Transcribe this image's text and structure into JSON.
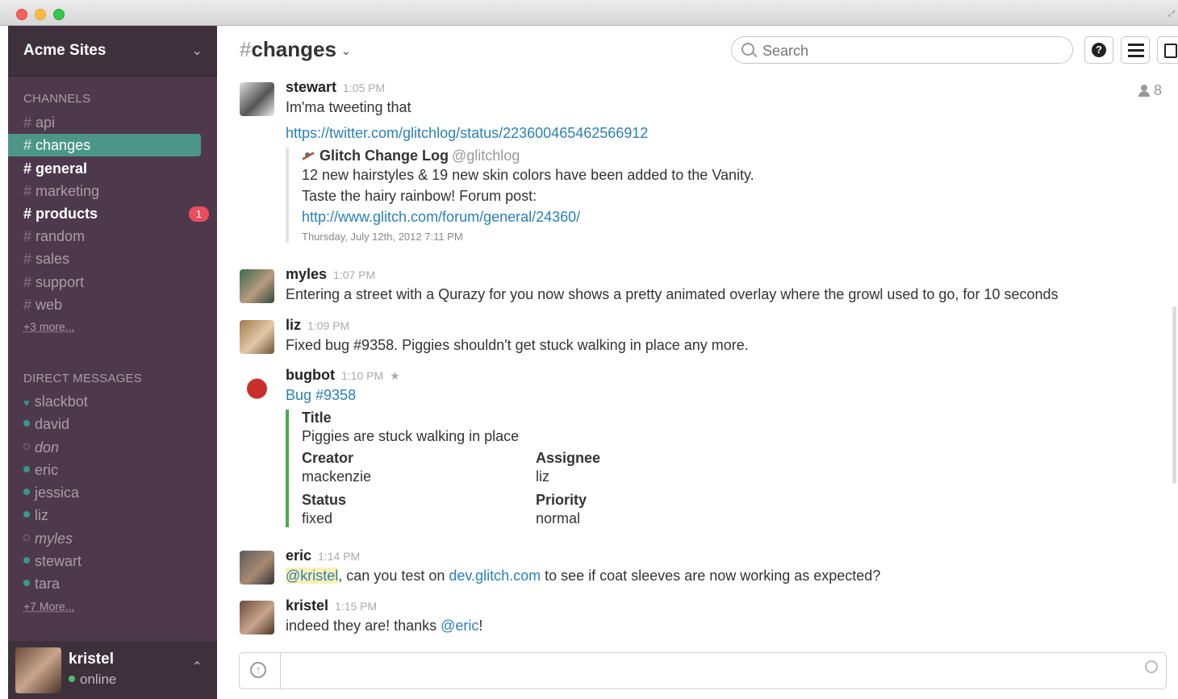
{
  "team": {
    "name": "Acme Sites"
  },
  "sidebar": {
    "channels_title": "CHANNELS",
    "channels": [
      {
        "name": "api"
      },
      {
        "name": "changes"
      },
      {
        "name": "general"
      },
      {
        "name": "marketing"
      },
      {
        "name": "products",
        "badge": "1"
      },
      {
        "name": "random"
      },
      {
        "name": "sales"
      },
      {
        "name": "support"
      },
      {
        "name": "web"
      }
    ],
    "channels_more": "+3 more...",
    "dm_title": "DIRECT MESSAGES",
    "dms": [
      {
        "name": "slackbot"
      },
      {
        "name": "david"
      },
      {
        "name": "don"
      },
      {
        "name": "eric"
      },
      {
        "name": "jessica"
      },
      {
        "name": "liz"
      },
      {
        "name": "myles"
      },
      {
        "name": "stewart"
      },
      {
        "name": "tara"
      }
    ],
    "dms_more": "+7 More..."
  },
  "me": {
    "name": "kristel",
    "status": "online"
  },
  "header": {
    "hash": "#",
    "channel": "changes",
    "search_placeholder": "Search",
    "member_count": "8"
  },
  "messages": [
    {
      "author": "stewart",
      "time": "1:05 PM",
      "text": "Im'ma tweeting that",
      "link": "https://twitter.com/glitchlog/status/223600465462566912",
      "tweet": {
        "name": "Glitch Change Log",
        "handle": "@glitchlog",
        "text": "12 new hairstyles & 19 new skin colors have been added to the Vanity. Taste the hairy rainbow! Forum post:",
        "link": "http://www.glitch.com/forum/general/24360/",
        "date": "Thursday, July 12th, 2012 7:11 PM"
      }
    },
    {
      "author": "myles",
      "time": "1:07 PM",
      "text": "Entering a street with a Qurazy for you now shows a pretty animated overlay where the growl used to go, for 10 seconds"
    },
    {
      "author": "liz",
      "time": "1:09 PM",
      "text": "Fixed bug #9358. Piggies shouldn't get stuck walking in place any more."
    },
    {
      "author": "bugbot",
      "time": "1:10 PM",
      "link": "Bug #9358",
      "fields": {
        "title_label": "Title",
        "title_value": "Piggies are stuck walking in place",
        "creator_label": "Creator",
        "creator_value": "mackenzie",
        "assignee_label": "Assignee",
        "assignee_value": "liz",
        "status_label": "Status",
        "status_value": "fixed",
        "priority_label": "Priority",
        "priority_value": "normal"
      }
    },
    {
      "author": "eric",
      "time": "1:14 PM",
      "mention": "@kristel",
      "text_a": ", can you test on ",
      "link": "dev.glitch.com",
      "text_b": " to see if coat sleeves are now working as expected?"
    },
    {
      "author": "kristel",
      "time": "1:15 PM",
      "text": "indeed they are! thanks ",
      "mention": "@eric",
      "text_b": "!"
    }
  ],
  "colors": {
    "sidebar": "#4d394b",
    "active_channel": "#4c9689",
    "badge": "#eb4d5c",
    "link": "#2a80b9"
  }
}
